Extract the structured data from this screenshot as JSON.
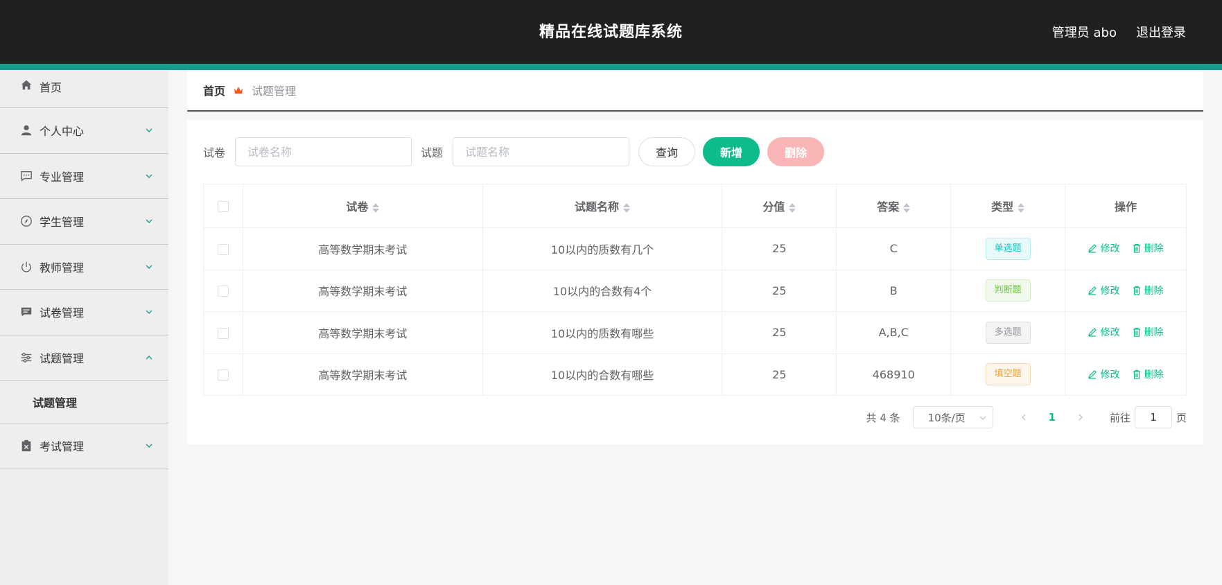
{
  "header": {
    "title": "精品在线试题库系统",
    "user_label": "管理员 abo",
    "logout_label": "退出登录"
  },
  "sidebar": {
    "items": [
      {
        "label": "首页",
        "icon": "home-icon"
      },
      {
        "label": "个人中心",
        "icon": "user-icon"
      },
      {
        "label": "专业管理",
        "icon": "chat-icon"
      },
      {
        "label": "学生管理",
        "icon": "compass-icon"
      },
      {
        "label": "教师管理",
        "icon": "power-icon"
      },
      {
        "label": "试卷管理",
        "icon": "message-icon"
      },
      {
        "label": "试题管理",
        "icon": "sliders-icon",
        "expanded": true
      },
      {
        "label": "考试管理",
        "icon": "clipboard-icon"
      }
    ],
    "submenu": {
      "label": "试题管理"
    }
  },
  "breadcrumb": {
    "home": "首页",
    "current": "试题管理"
  },
  "search": {
    "paper_label": "试卷",
    "paper_placeholder": "试卷名称",
    "question_label": "试题",
    "question_placeholder": "试题名称",
    "query_button": "查询",
    "add_button": "新增",
    "delete_button": "删除"
  },
  "table": {
    "columns": [
      "试卷",
      "试题名称",
      "分值",
      "答案",
      "类型",
      "操作"
    ],
    "rows": [
      {
        "paper": "高等数学期末考试",
        "question": "10以内的质数有几个",
        "score": "25",
        "answer": "C",
        "type": "单选题"
      },
      {
        "paper": "高等数学期末考试",
        "question": "10以内的合数有4个",
        "score": "25",
        "answer": "B",
        "type": "判断题"
      },
      {
        "paper": "高等数学期末考试",
        "question": "10以内的质数有哪些",
        "score": "25",
        "answer": "A,B,C",
        "type": "多选题"
      },
      {
        "paper": "高等数学期末考试",
        "question": "10以内的合数有哪些",
        "score": "25",
        "answer": "468910",
        "type": "填空题"
      }
    ],
    "edit_label": "修改",
    "delete_label": "删除"
  },
  "pagination": {
    "total": "共 4 条",
    "page_size": "10条/页",
    "current_page": "1",
    "goto_label": "前往",
    "goto_value": "1",
    "page_suffix": "页"
  },
  "colors": {
    "accent": "#0cbc8b",
    "header_bg": "#202020",
    "header_bar": "#1a9a8a",
    "tag_single": "#13c2c2",
    "tag_judge": "#67c23a",
    "tag_multi": "#909399",
    "tag_fill": "#e6a23c"
  }
}
